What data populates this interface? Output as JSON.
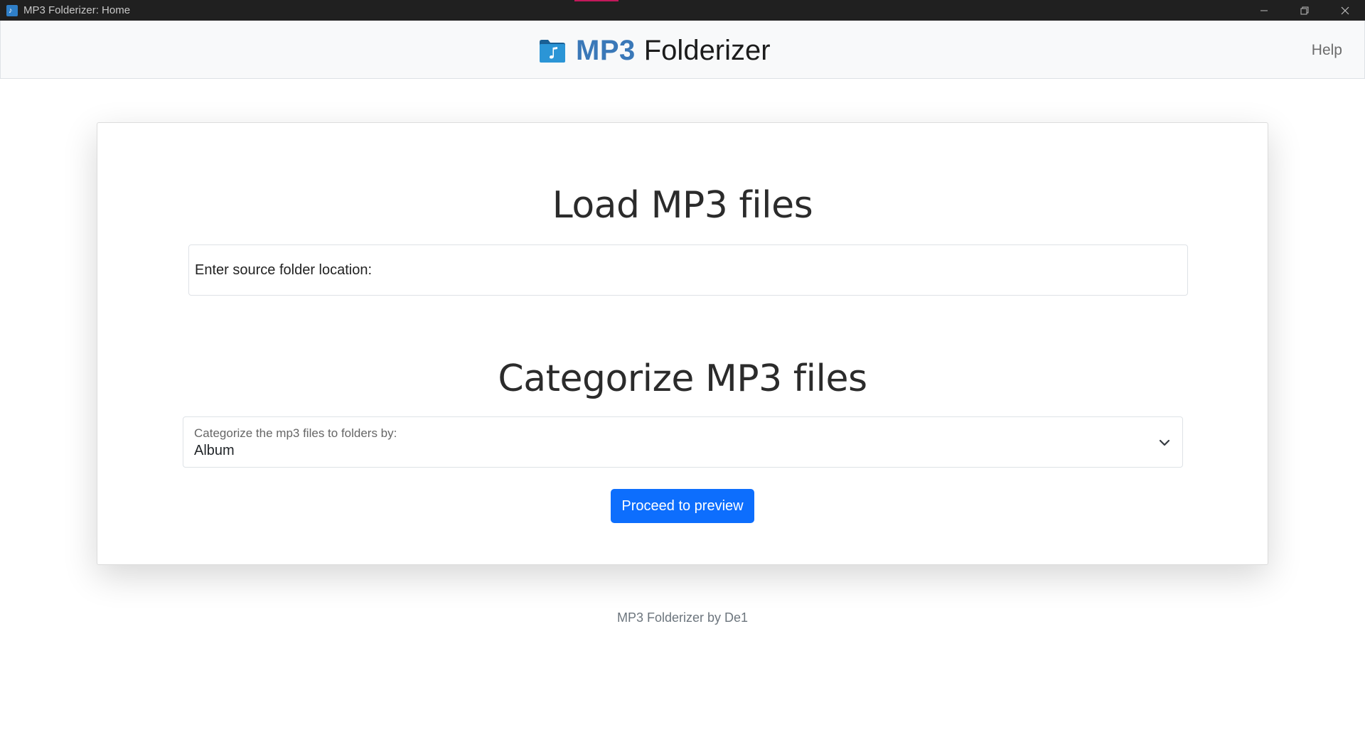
{
  "window": {
    "title": "MP3 Folderizer: Home"
  },
  "navbar": {
    "brand_strong": "MP3",
    "brand_rest": "Folderizer",
    "help_label": "Help"
  },
  "load_section": {
    "title": "Load MP3 files",
    "source_placeholder": "Enter source folder location:",
    "source_value": ""
  },
  "categorize_section": {
    "title": "Categorize MP3 files",
    "select_label": "Categorize the mp3 files to folders by:",
    "selected_value": "Album"
  },
  "actions": {
    "proceed_label": "Proceed to preview"
  },
  "footer": {
    "text": "MP3 Folderizer by De1"
  },
  "colors": {
    "brand_blue": "#3a78b8",
    "primary_button": "#0d6efd",
    "navbar_bg": "#f8f9fa",
    "titlebar_bg": "#202020"
  },
  "icons": {
    "app": "music-folder-icon",
    "select": "chevron-down-icon",
    "minimize": "minimize-icon",
    "maximize": "restore-icon",
    "close": "close-icon"
  }
}
